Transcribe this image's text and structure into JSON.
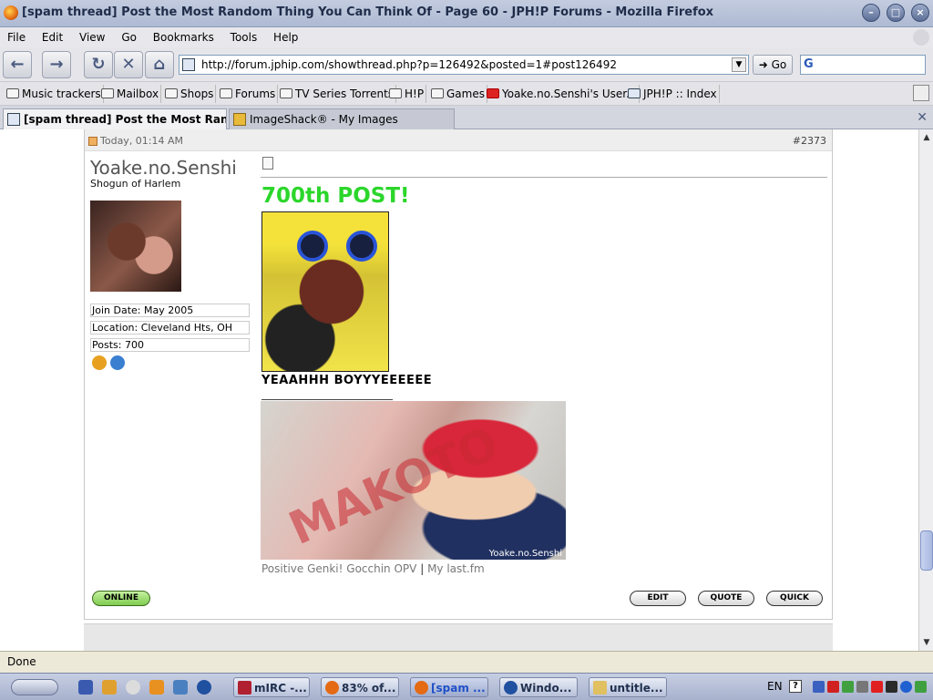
{
  "window": {
    "title": "[spam thread] Post the Most Random Thing You Can Think Of - Page 60 - JPH!P Forums - Mozilla Firefox"
  },
  "menu": [
    "File",
    "Edit",
    "View",
    "Go",
    "Bookmarks",
    "Tools",
    "Help"
  ],
  "toolbar": {
    "url": "http://forum.jphip.com/showthread.php?p=126492&posted=1#post126492",
    "go_label": "Go",
    "search_engine_letter": "G"
  },
  "bookmarks": [
    {
      "label": "Music trackers",
      "icon": "folder-icon"
    },
    {
      "label": "Mailbox",
      "icon": "folder-icon"
    },
    {
      "label": "Shops",
      "icon": "folder-icon"
    },
    {
      "label": "Forums",
      "icon": "folder-icon"
    },
    {
      "label": "TV Series Torrents",
      "icon": "folder-icon"
    },
    {
      "label": "H!P",
      "icon": "folder-icon"
    },
    {
      "label": "Games",
      "icon": "folder-icon"
    },
    {
      "label": "Yoake.no.Senshi's User...",
      "icon": "lastfm-icon"
    },
    {
      "label": "JPH!P :: Index",
      "icon": "jphip-icon"
    }
  ],
  "tabs": [
    {
      "label": "[spam thread] Post the Most Rand...",
      "active": true
    },
    {
      "label": "ImageShack® - My Images",
      "active": false
    }
  ],
  "post": {
    "date": "Today, 01:14 AM",
    "number": "#2373",
    "username": "Yoake.no.Senshi",
    "user_title": "Shogun of Harlem",
    "join_date": "Join Date: May 2005",
    "location": "Location: Cleveland Hts, OH",
    "posts": "Posts: 700",
    "headline": "700th POST!",
    "caption": "YEAAHHH BOYYYEEEEEE",
    "signature_tag": "Yoake.no.Senshi",
    "sig_link_1": "Positive Genki! Gocchin OPV",
    "sig_separator": "|",
    "sig_link_2": "My last.fm",
    "online_label": "ONLINE",
    "edit_label": "EDIT",
    "quote_label": "QUOTE",
    "quick_label": "QUICK"
  },
  "status": "Done",
  "taskbar": {
    "tasks": [
      {
        "label": "mIRC -...",
        "active": false
      },
      {
        "label": "83% of...",
        "active": false
      },
      {
        "label": "[spam ...",
        "active": true
      },
      {
        "label": "Windo...",
        "active": false
      },
      {
        "label": "untitle...",
        "active": false
      }
    ],
    "lang": "EN",
    "help": "?"
  }
}
